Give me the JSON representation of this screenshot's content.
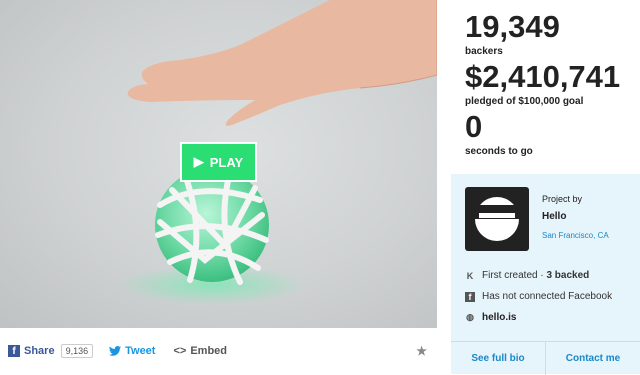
{
  "video": {
    "play_label": "PLAY"
  },
  "share": {
    "share_label": "Share",
    "share_count": "9,136",
    "tweet_label": "Tweet",
    "embed_label": "Embed"
  },
  "stats": {
    "backers_value": "19,349",
    "backers_label": "backers",
    "pledged_value": "$2,410,741",
    "pledged_label": "pledged of $100,000 goal",
    "seconds_value": "0",
    "seconds_label": "seconds to go"
  },
  "project": {
    "by_label": "Project by",
    "creator": "Hello",
    "location": "San Francisco, CA",
    "created_text": "First created",
    "backed_text": "3 backed",
    "facebook_text": "Has not connected Facebook",
    "website": "hello.is",
    "see_bio": "See full bio",
    "contact": "Contact me"
  }
}
